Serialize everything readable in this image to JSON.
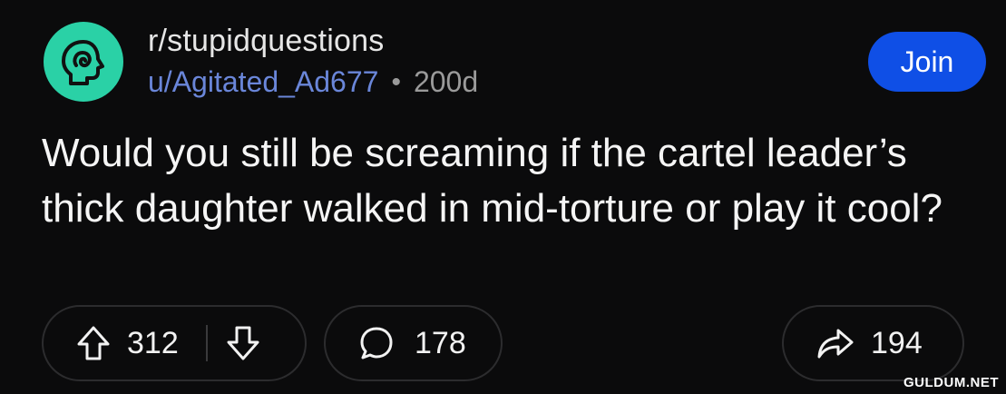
{
  "post": {
    "subreddit": "r/stupidquestions",
    "user": "u/Agitated_Ad677",
    "separator": "•",
    "age": "200d",
    "title": "Would you still be screaming if the cartel leader’s thick daughter walked in mid-torture or play it cool?",
    "join_label": "Join"
  },
  "actions": {
    "upvotes": "312",
    "comments": "178",
    "shares": "194"
  },
  "watermark": "GULDUM.NET",
  "icons": {
    "avatar": "subreddit-brain-icon",
    "upvote": "arrow-up-icon",
    "downvote": "arrow-down-icon",
    "comment": "speech-bubble-icon",
    "share": "share-arrow-icon"
  },
  "colors": {
    "background": "#0b0b0c",
    "avatar": "#2ad1a6",
    "join_button": "#0f4fe6",
    "username": "#6a86d9"
  }
}
